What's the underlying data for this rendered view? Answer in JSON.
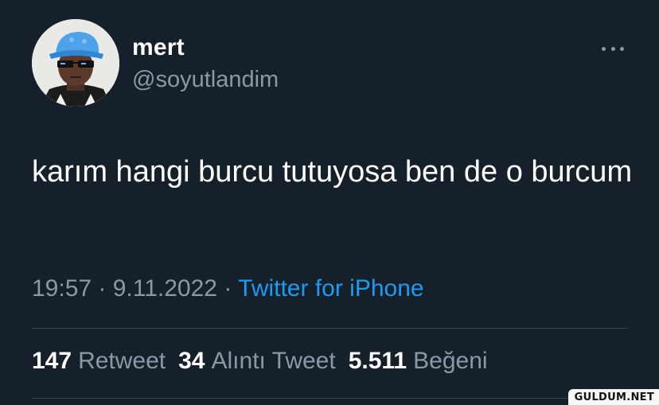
{
  "user": {
    "display_name": "mert",
    "handle": "@soyutlandim"
  },
  "more_icon": "more-horizontal-icon",
  "tweet": {
    "text": "karım hangi burcu tutuyosa ben de o burcum",
    "time": "19:57",
    "separator": "·",
    "date": "9.11.2022",
    "source": "Twitter for iPhone"
  },
  "stats": {
    "retweets": {
      "count": "147",
      "label": "Retweet"
    },
    "quotes": {
      "count": "34",
      "label": "Alıntı Tweet"
    },
    "likes": {
      "count": "5.511",
      "label": "Beğeni"
    }
  },
  "watermark": "GULDUM.NET",
  "colors": {
    "background": "#15202b",
    "secondary_text": "#8b98a5",
    "link": "#1d9bf0",
    "divider": "#38444d"
  }
}
